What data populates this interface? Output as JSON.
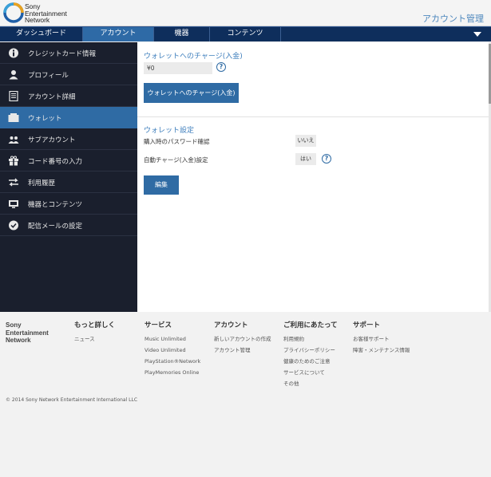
{
  "header": {
    "brand_lines": [
      "Sony",
      "Entertainment",
      "Network"
    ],
    "title": "アカウント管理",
    "logo_icon": "sen-logo-icon"
  },
  "nav": {
    "tabs": [
      {
        "label": "ダッシュボード",
        "active": false
      },
      {
        "label": "アカウント",
        "active": true
      },
      {
        "label": "機器",
        "active": false
      },
      {
        "label": "コンテンツ",
        "active": false
      }
    ],
    "menu_icon": "chevron-down-icon"
  },
  "sidebar": {
    "items": [
      {
        "label": "クレジットカード情報",
        "icon": "info-icon",
        "active": false
      },
      {
        "label": "プロフィール",
        "icon": "person-icon",
        "active": false
      },
      {
        "label": "アカウント詳細",
        "icon": "document-icon",
        "active": false
      },
      {
        "label": "ウォレット",
        "icon": "wallet-icon",
        "active": true
      },
      {
        "label": "サブアカウント",
        "icon": "people-icon",
        "active": false
      },
      {
        "label": "コード番号の入力",
        "icon": "gift-icon",
        "active": false
      },
      {
        "label": "利用履歴",
        "icon": "transfer-icon",
        "active": false
      },
      {
        "label": "機器とコンテンツ",
        "icon": "device-icon",
        "active": false
      },
      {
        "label": "配信メールの設定",
        "icon": "check-circle-icon",
        "active": false
      }
    ]
  },
  "wallet": {
    "charge_title": "ウォレットへのチャージ(入金)",
    "balance": "¥0",
    "charge_button": "ウォレットへのチャージ(入金)",
    "settings_title": "ウォレット設定",
    "settings": [
      {
        "label": "購入時のパスワード確認",
        "value": "いいえ",
        "has_help": false
      },
      {
        "label": "自動チャージ(入金)設定",
        "value": "はい",
        "has_help": true
      }
    ],
    "edit_button": "編集",
    "help_glyph": "?"
  },
  "footer": {
    "brand_lines": [
      "Sony",
      "Entertainment",
      "Network"
    ],
    "columns": [
      {
        "heading": "もっと詳しく",
        "links": [
          "ニュース"
        ]
      },
      {
        "heading": "サービス",
        "links": [
          "Music Unlimited",
          "Video Unlimited",
          "PlayStation®Network",
          "PlayMemories Online"
        ]
      },
      {
        "heading": "アカウント",
        "links": [
          "新しいアカウントの作成",
          "アカウント管理"
        ]
      },
      {
        "heading": "ご利用にあたって",
        "links": [
          "利用規約",
          "プライバシーポリシー",
          "健康のためのご注意",
          "サービスについて",
          "その他"
        ]
      },
      {
        "heading": "サポート",
        "links": [
          "お客様サポート",
          "障害・メンテナンス情報"
        ]
      }
    ],
    "copyright": "© 2014 Sony Network Entertainment International LLC"
  },
  "colors": {
    "accent": "#2f6ba4",
    "nav_bg": "#0e2e5c",
    "sidebar_bg": "#1a1f2d",
    "title_blue": "#3f7fbd"
  }
}
